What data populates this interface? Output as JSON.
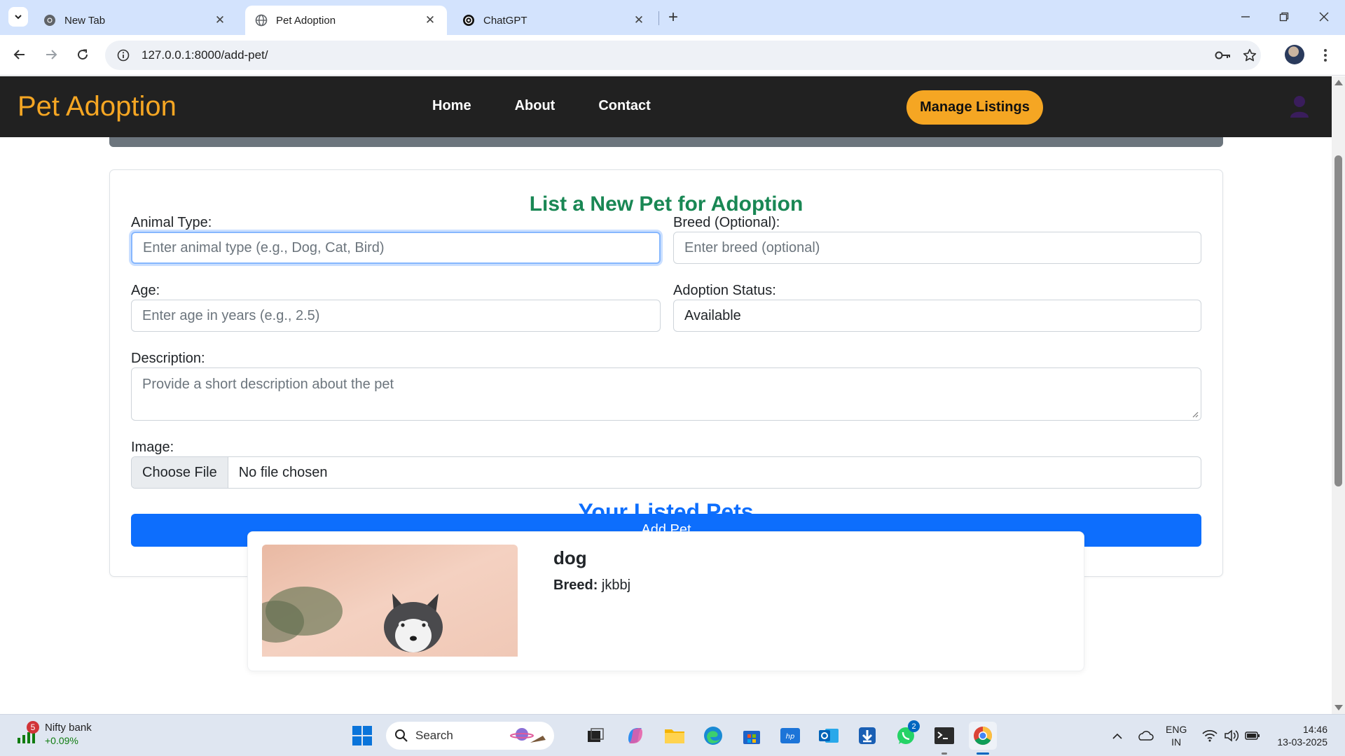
{
  "browser": {
    "tabs": [
      {
        "label": "New Tab",
        "icon": "chrome-icon",
        "active": false
      },
      {
        "label": "Pet Adoption",
        "icon": "globe-icon",
        "active": true
      },
      {
        "label": "ChatGPT",
        "icon": "openai-icon",
        "active": false
      }
    ],
    "url": "127.0.0.1:8000/add-pet/"
  },
  "site": {
    "brand": "Pet Adoption",
    "nav": [
      "Home",
      "About",
      "Contact"
    ],
    "manage_button": "Manage Listings",
    "brand_color": "#f5a623"
  },
  "form": {
    "title": "List a New Pet for Adoption",
    "animal_type": {
      "label": "Animal Type:",
      "placeholder": "Enter animal type (e.g., Dog, Cat, Bird)"
    },
    "breed": {
      "label": "Breed (Optional):",
      "placeholder": "Enter breed (optional)"
    },
    "age": {
      "label": "Age:",
      "placeholder": "Enter age in years (e.g., 2.5)"
    },
    "status": {
      "label": "Adoption Status:",
      "value": "Available"
    },
    "description": {
      "label": "Description:",
      "placeholder": "Provide a short description about the pet"
    },
    "image": {
      "label": "Image:",
      "button": "Choose File",
      "status": "No file chosen"
    },
    "submit": "Add Pet"
  },
  "listed": {
    "title": "Your Listed Pets",
    "pets": [
      {
        "name": "dog",
        "breed_label": "Breed:",
        "breed": "jkbbj"
      }
    ]
  },
  "taskbar": {
    "widget": {
      "badge": "5",
      "title": "Nifty bank",
      "value": "+0.09%"
    },
    "search": "Search",
    "whatsapp_badge": "2",
    "lang": [
      "ENG",
      "IN"
    ],
    "time": "14:46",
    "date": "13-03-2025"
  }
}
